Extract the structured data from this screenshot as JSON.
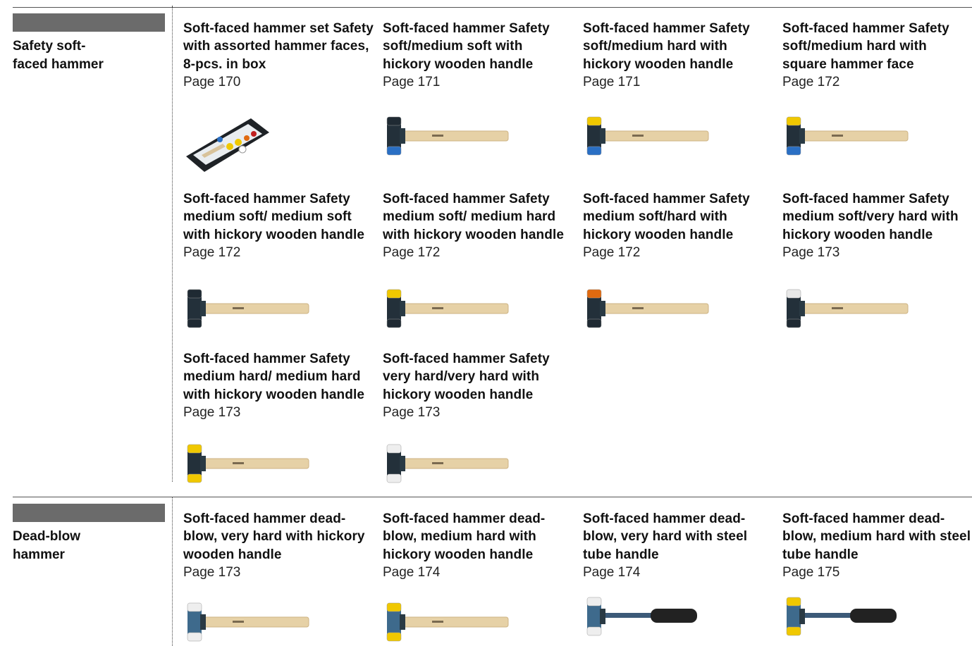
{
  "sections": [
    {
      "title": "Safety soft-\nfaced hammer",
      "items": [
        {
          "title": "Soft-faced hammer set Safety with assorted hammer faces, 8-pcs. in box",
          "page": "Page 170",
          "image": "hammer-set-case-icon",
          "head1": "#1f2a33",
          "head2": "#e8c800",
          "handle": "wood"
        },
        {
          "title": "Soft-faced hammer Safety soft/medium soft with hickory wooden handle",
          "page": "Page 171",
          "image": "hammer-icon",
          "head1": "#1f2a33",
          "head2": "#2a6fc4",
          "handle": "wood"
        },
        {
          "title": "Soft-faced hammer Safety soft/medium hard with hickory wooden handle",
          "page": "Page 171",
          "image": "hammer-icon",
          "head1": "#f0c800",
          "head2": "#2a6fc4",
          "handle": "wood"
        },
        {
          "title": "Soft-faced hammer Safety soft/medium hard with square hammer face",
          "page": "Page 172",
          "image": "hammer-icon",
          "head1": "#f0c800",
          "head2": "#2a6fc4",
          "handle": "wood"
        },
        {
          "title": "Soft-faced hammer Safety medium soft/ medium soft with hickory wooden handle",
          "page": "Page 172",
          "image": "hammer-icon",
          "head1": "#1f2a33",
          "head2": "#1f2a33",
          "handle": "wood"
        },
        {
          "title": "Soft-faced hammer Safety medium soft/ medium hard with hickory wooden handle",
          "page": "Page 172",
          "image": "hammer-icon",
          "head1": "#f0c800",
          "head2": "#1f2a33",
          "handle": "wood"
        },
        {
          "title": "Soft-faced hammer Safety medium soft/hard with hickory wooden handle",
          "page": "Page 172",
          "image": "hammer-icon",
          "head1": "#e06a10",
          "head2": "#1f2a33",
          "handle": "wood"
        },
        {
          "title": "Soft-faced hammer Safety medium soft/very hard with hickory wooden handle",
          "page": "Page 173",
          "image": "hammer-icon",
          "head1": "#e8e8e8",
          "head2": "#1f2a33",
          "handle": "wood"
        },
        {
          "title": "Soft-faced hammer Safety medium hard/ medium hard with hickory wooden handle",
          "page": "Page 173",
          "image": "hammer-icon",
          "head1": "#f0c800",
          "head2": "#f0c800",
          "handle": "wood"
        },
        {
          "title": "Soft-faced hammer Safety very hard/very hard with hickory wooden handle",
          "page": "Page 173",
          "image": "hammer-icon",
          "head1": "#eeeeee",
          "head2": "#eeeeee",
          "handle": "wood"
        }
      ]
    },
    {
      "title": "Dead-blow\nhammer",
      "items": [
        {
          "title": "Soft-faced hammer dead-blow, very hard with hickory wooden handle",
          "page": "Page 173",
          "image": "dead-blow-hammer-icon",
          "head1": "#eeeeee",
          "head2": "#eeeeee",
          "handle": "wood"
        },
        {
          "title": "Soft-faced hammer dead-blow, medium hard with hickory wooden handle",
          "page": "Page 174",
          "image": "dead-blow-hammer-icon",
          "head1": "#f0c800",
          "head2": "#f0c800",
          "handle": "wood"
        },
        {
          "title": "Soft-faced hammer dead-blow, very hard with steel tube handle",
          "page": "Page 174",
          "image": "dead-blow-hammer-icon",
          "head1": "#eeeeee",
          "head2": "#eeeeee",
          "handle": "steel"
        },
        {
          "title": "Soft-faced hammer dead-blow, medium hard with steel tube handle",
          "page": "Page 175",
          "image": "dead-blow-hammer-icon",
          "head1": "#f0c800",
          "head2": "#f0c800",
          "handle": "steel"
        }
      ]
    }
  ]
}
